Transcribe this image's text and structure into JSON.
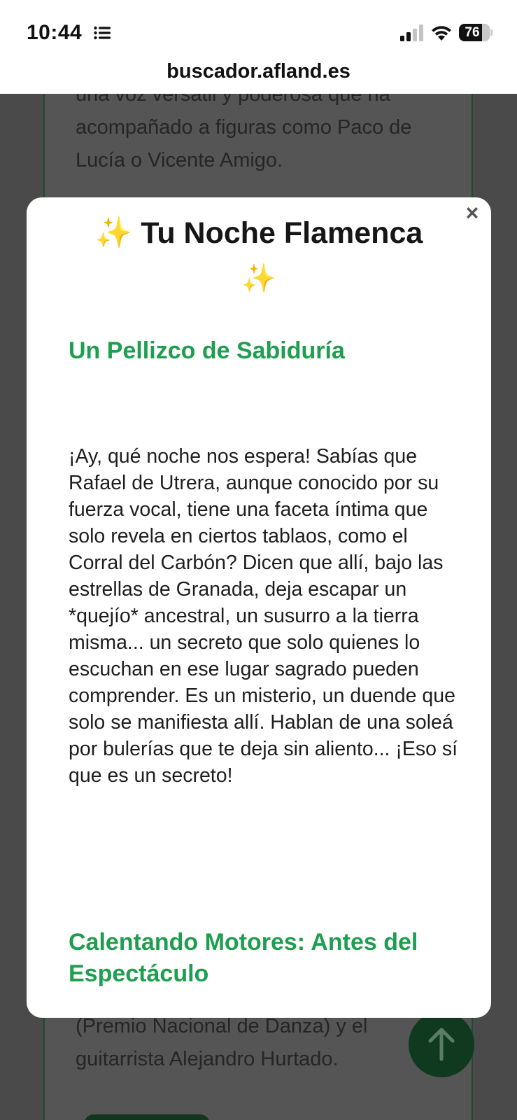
{
  "status_bar": {
    "time": "10:44",
    "battery_percent": "76",
    "battery_level": 0.76,
    "icons": [
      "list-icon",
      "signal-icon",
      "wifi-icon",
      "battery-icon"
    ]
  },
  "browser": {
    "url": "buscador.afland.es"
  },
  "background_page": {
    "text_top": "una voz versátil y poderosa que ha acompañado a figuras como Paco de Lucía o Vicente Amigo.",
    "text_bottom": "(Premio Nacional de Danza) y el guitarrista Alejandro Hurtado."
  },
  "modal": {
    "close_label": "×",
    "sparkle_left": "✨",
    "title": "Tu Noche Flamenca",
    "sparkle_right": "✨",
    "section_1_heading": "Un Pellizco de Sabiduría",
    "section_1_text": "¡Ay, qué noche nos espera! Sabías que Rafael de Utrera, aunque conocido por su fuerza vocal, tiene una faceta íntima que solo revela en ciertos tablaos, como el Corral del Carbón? Dicen que allí, bajo las estrellas de Granada, deja escapar un *quejío* ancestral, un susurro a la tierra misma... un secreto que solo quienes lo escuchan en ese lugar sagrado pueden comprender. Es un misterio, un duende que solo se manifiesta allí. Hablan de una soleá por bulerías que te deja sin aliento... ¡Eso sí que es un secreto!",
    "section_2_heading": "Calentando Motores: Antes del Espectáculo"
  },
  "colors": {
    "accent_green": "#1e9e4f",
    "overlay_gray": "#4a4a4a",
    "sparkle": "#f4c430"
  }
}
